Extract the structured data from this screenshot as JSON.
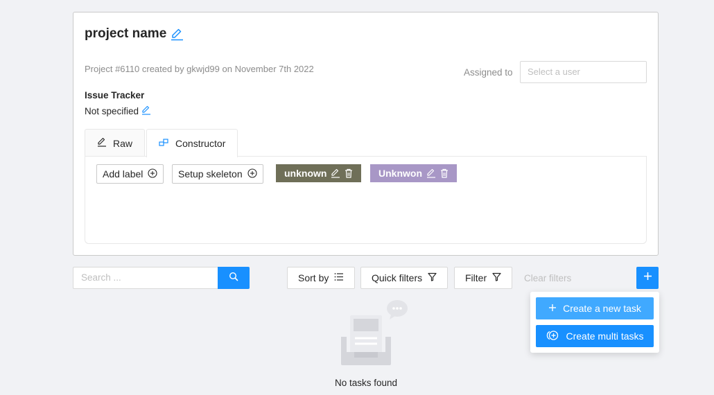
{
  "project": {
    "name": "project name",
    "subtitle": "Project #6110 created by gkwjd99 on November 7th 2022",
    "assigned_label": "Assigned to",
    "assigned_placeholder": "Select a user",
    "issue_tracker_title": "Issue Tracker",
    "issue_tracker_value": "Not specified"
  },
  "tabs": [
    {
      "label": "Raw",
      "icon": "pencil-icon"
    },
    {
      "label": "Constructor",
      "icon": "shapes-icon",
      "active": true
    }
  ],
  "constructor": {
    "add_label": "Add label",
    "setup_skeleton": "Setup skeleton",
    "labels": [
      {
        "name": "unknown",
        "color": "#6f6f58"
      },
      {
        "name": "Unknwon",
        "color": "#a897c6"
      }
    ]
  },
  "toolbar": {
    "search_placeholder": "Search ...",
    "sort_by": "Sort by",
    "quick_filters": "Quick filters",
    "filter": "Filter",
    "clear_filters": "Clear filters"
  },
  "create_menu": {
    "new_task": "Create a new task",
    "multi_tasks": "Create multi tasks"
  },
  "empty_state": {
    "text": "No tasks found"
  },
  "colors": {
    "accent": "#1890ff",
    "accent_light": "#40a9ff"
  }
}
